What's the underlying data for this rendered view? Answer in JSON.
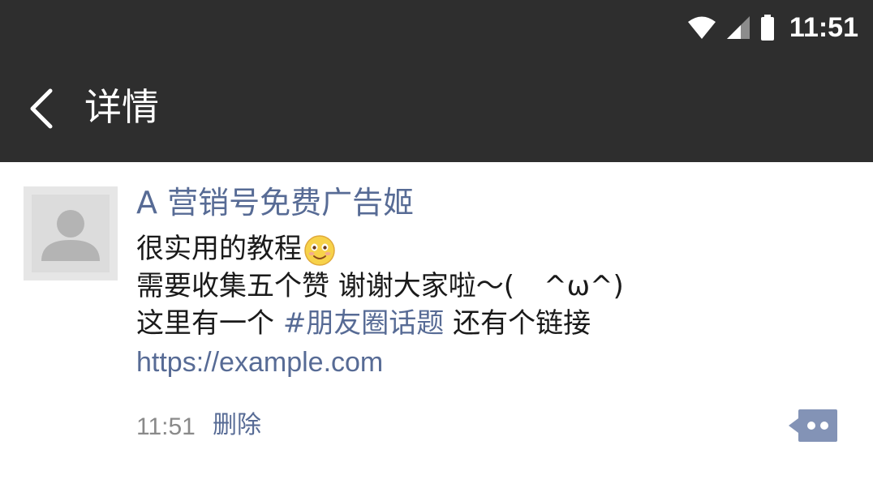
{
  "status_bar": {
    "time": "11:51",
    "icons": [
      "wifi-icon",
      "cellular-signal-icon",
      "battery-icon"
    ]
  },
  "header": {
    "title": "详情",
    "back_icon": "chevron-left-icon"
  },
  "post": {
    "author": "A 营销号免费广告姬",
    "lines": {
      "line1": "很实用的教程",
      "line2": "需要收集五个赞 谢谢大家啦～(",
      "line2_tail": "^ω^)",
      "line3_pre": "这里有一个 ",
      "topic": "#朋友圈话题",
      "line3_post": " 还有个链接"
    },
    "link": "https://example.com",
    "time": "11:51",
    "delete_label": "删除",
    "emoji": "smile-emoji-icon"
  },
  "colors": {
    "topbar": "#2e2e2e",
    "link_blue": "#576b95",
    "text": "#1a1a1a",
    "muted": "#8a8a8a"
  }
}
